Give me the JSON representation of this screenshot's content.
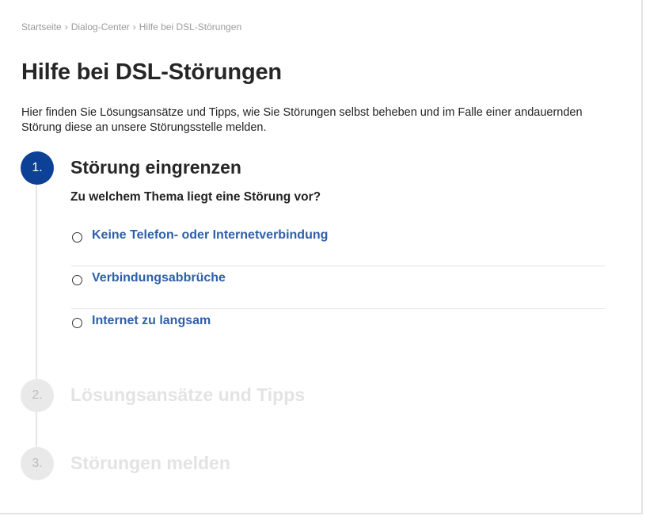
{
  "breadcrumb": {
    "items": [
      "Startseite",
      "Dialog-Center",
      "Hilfe bei DSL-Störungen"
    ],
    "separator": "›"
  },
  "page": {
    "title": "Hilfe bei DSL-Störungen",
    "intro": "Hier finden Sie Lösungsansätze und Tipps, wie Sie Störungen selbst beheben und im Falle einer andauernden Störung diese an unsere Störungsstelle melden."
  },
  "steps": [
    {
      "number": "1.",
      "title": "Störung eingrenzen",
      "state": "active",
      "question": "Zu welchem Thema liegt eine Störung vor?",
      "options": [
        {
          "label": "Keine Telefon- oder Internetverbindung",
          "selected": false
        },
        {
          "label": "Verbindungsabbrüche",
          "selected": false
        },
        {
          "label": "Internet zu langsam",
          "selected": false
        }
      ]
    },
    {
      "number": "2.",
      "title": "Lösungsansätze und Tipps",
      "state": "inactive"
    },
    {
      "number": "3.",
      "title": "Störungen melden",
      "state": "inactive"
    }
  ],
  "colors": {
    "accent": "#0d4195",
    "link": "#2e5fa8",
    "inactive_circle": "#e9e9e9",
    "inactive_text": "#e3e3e3"
  }
}
